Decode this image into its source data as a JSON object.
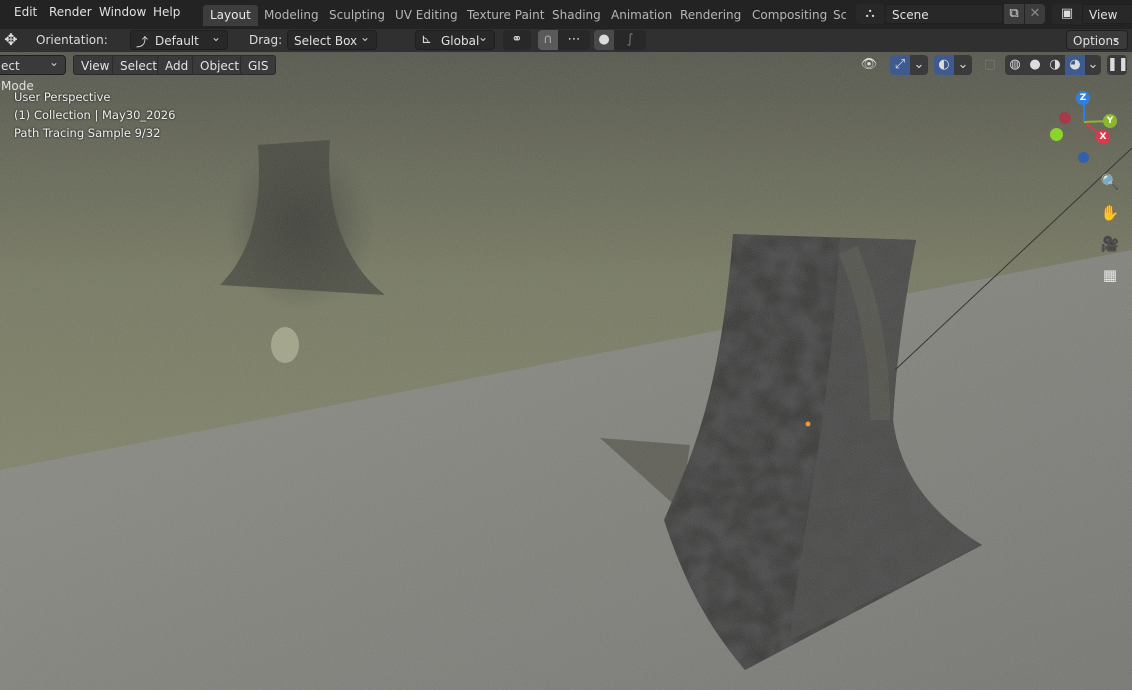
{
  "topbar": {
    "menus": [
      "Edit",
      "Render",
      "Window",
      "Help"
    ],
    "workspaces": [
      "Layout",
      "Modeling",
      "Sculpting",
      "UV Editing",
      "Texture Paint",
      "Shading",
      "Animation",
      "Rendering",
      "Compositing",
      "Sc"
    ],
    "active_workspace": "Layout",
    "scene_name": "Scene",
    "view_layer": "View Lay"
  },
  "tool_header": {
    "orientation_label": "Orientation:",
    "orientation_value": "Default",
    "drag_label": "Drag:",
    "drag_value": "Select Box",
    "transform_orientation": "Global",
    "options_label": "Options"
  },
  "viewport_header": {
    "mode": "ect Mode",
    "menus": [
      "View",
      "Select",
      "Add",
      "Object",
      "GIS"
    ]
  },
  "overlay": {
    "line1": "User Perspective",
    "line2": "(1) Collection | May30_2026",
    "line3": "Path Tracing Sample 9/32"
  },
  "gizmo": {
    "z": "Z",
    "y": "Y",
    "x": "X"
  },
  "colors": {
    "x_axis": "#e0374c",
    "y_axis": "#8ab72c",
    "z_axis": "#2f7fe0",
    "active_tab": "#3d3d3d"
  }
}
